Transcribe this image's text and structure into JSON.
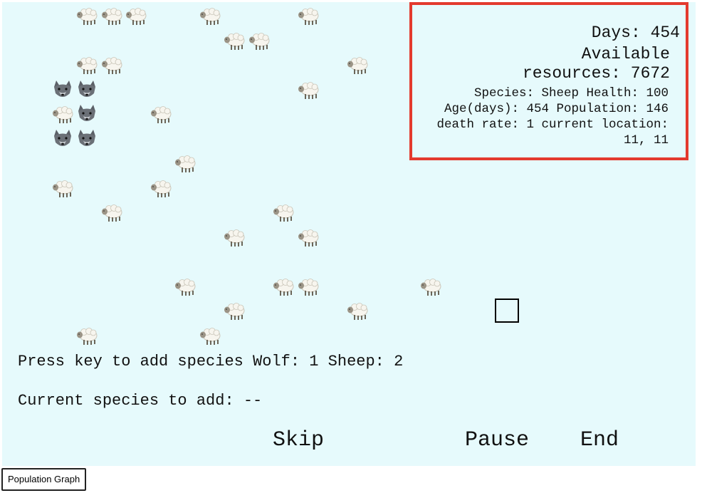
{
  "info": {
    "days": "Days: 454",
    "resources": "Available resources: 7672",
    "species_info": "Species: Sheep Health: 100 Age(days): 454 Population: 146 death rate: 1 current location: 11, 11"
  },
  "instructions": {
    "add_species": "Press key to add species Wolf: 1 Sheep: 2",
    "current_species": "Current species to add: --"
  },
  "controls": {
    "skip": "Skip",
    "pause": "Pause",
    "end": "End"
  },
  "population_graph_button": "Population Graph",
  "grid": {
    "sheep_cells": [
      [
        2,
        0
      ],
      [
        3,
        0
      ],
      [
        4,
        0
      ],
      [
        7,
        0
      ],
      [
        11,
        0
      ],
      [
        8,
        1
      ],
      [
        9,
        1
      ],
      [
        2,
        2
      ],
      [
        3,
        2
      ],
      [
        13,
        2
      ],
      [
        11,
        3
      ],
      [
        1,
        4
      ],
      [
        5,
        4
      ],
      [
        6,
        6
      ],
      [
        1,
        7
      ],
      [
        5,
        7
      ],
      [
        3,
        8
      ],
      [
        10,
        8
      ],
      [
        8,
        9
      ],
      [
        11,
        9
      ],
      [
        6,
        11
      ],
      [
        10,
        11
      ],
      [
        11,
        11
      ],
      [
        16,
        11
      ],
      [
        8,
        12
      ],
      [
        13,
        12
      ],
      [
        2,
        13
      ],
      [
        7,
        13
      ]
    ],
    "wolf_cells": [
      [
        1,
        3
      ],
      [
        2,
        3
      ],
      [
        2,
        4
      ],
      [
        1,
        5
      ],
      [
        2,
        5
      ]
    ],
    "selected_cell": [
      20,
      12
    ]
  },
  "colors": {
    "background": "#e6fafc",
    "info_border": "#e33a2e"
  },
  "icons": {
    "sheep": "sheep-icon",
    "wolf": "wolf-icon"
  }
}
